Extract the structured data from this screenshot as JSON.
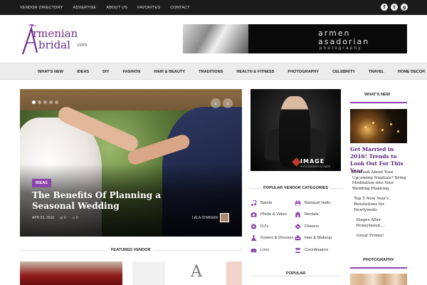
{
  "topbar": {
    "links": [
      "VENDOR DIRECTORY",
      "ADVERTISE",
      "ABOUT US",
      "FAVORITES",
      "CONTACT"
    ],
    "social": [
      "facebook-icon",
      "twitter-icon",
      "google-plus-icon"
    ]
  },
  "logo": {
    "line1": "rmenian",
    "line2": "bridal",
    "suffix": ".com"
  },
  "banner": {
    "line1": "armen",
    "line2": "asadorian",
    "line3": "photography"
  },
  "nav": {
    "items": [
      "WHAT'S NEW",
      "IDEAS",
      "DIY",
      "FASHION",
      "HAIR & BEAUTY",
      "TRADITIONS",
      "HEALTH & FITNESS",
      "PHOTOGRAPHY",
      "CELEBRITY",
      "TRAVEL",
      "HOME DECOR"
    ]
  },
  "hero": {
    "category": "IDEAS",
    "title": "The Benefits Of Planning a Seasonal Wedding",
    "date": "APR 26, 2016",
    "views": "0",
    "comments": "0",
    "author": "LALA OHANIAN",
    "prev_icon": "‹",
    "next_icon": "›"
  },
  "featured_vendor": {
    "title": "FEATURED VENDOR",
    "logo_letter": "A"
  },
  "ad": {
    "brand": "IMAGE",
    "brand_sub": "PHOTOGRAPHY & VIDEO"
  },
  "vendor_categories": {
    "title": "POPULAR VENDOR CATEGORIES",
    "items": [
      {
        "label": "Bands",
        "icon": "bands-icon"
      },
      {
        "label": "Banquet Halls",
        "icon": "banquet-halls-icon"
      },
      {
        "label": "Photo & Video",
        "icon": "camera-icon"
      },
      {
        "label": "Rentals",
        "icon": "rentals-icon"
      },
      {
        "label": "DJ's",
        "icon": "dj-icon"
      },
      {
        "label": "Flowers",
        "icon": "flowers-icon"
      },
      {
        "label": "Gowns & Dresses",
        "icon": "gown-icon"
      },
      {
        "label": "Hair & Makeup",
        "icon": "hair-makeup-icon"
      },
      {
        "label": "Limo",
        "icon": "limo-icon"
      },
      {
        "label": "Coordinators",
        "icon": "coordinators-icon"
      }
    ]
  },
  "popular": {
    "title": "POPULAR"
  },
  "whats_new": {
    "title": "WHAT'S NEW",
    "headline": "Get Married in 2016! Trends to Look Out For This Year",
    "items": [
      {
        "num": "",
        "text": "Stressed About Your Upcoming Nuptials? Bring Meditation into Your Wedding Planning"
      },
      {
        "num": "",
        "text": "Top 5 New Year's Resolutions for Newlyweds"
      },
      {
        "num": "",
        "text": "Stages After Honeymoon...."
      },
      {
        "num": "",
        "text": "Great Promo!"
      }
    ]
  },
  "photography": {
    "title": "PHOTOGRAPHY"
  },
  "colors": {
    "accent": "#8e44ad",
    "topbar": "#1b1b1b",
    "nav_bg": "#ececec"
  }
}
